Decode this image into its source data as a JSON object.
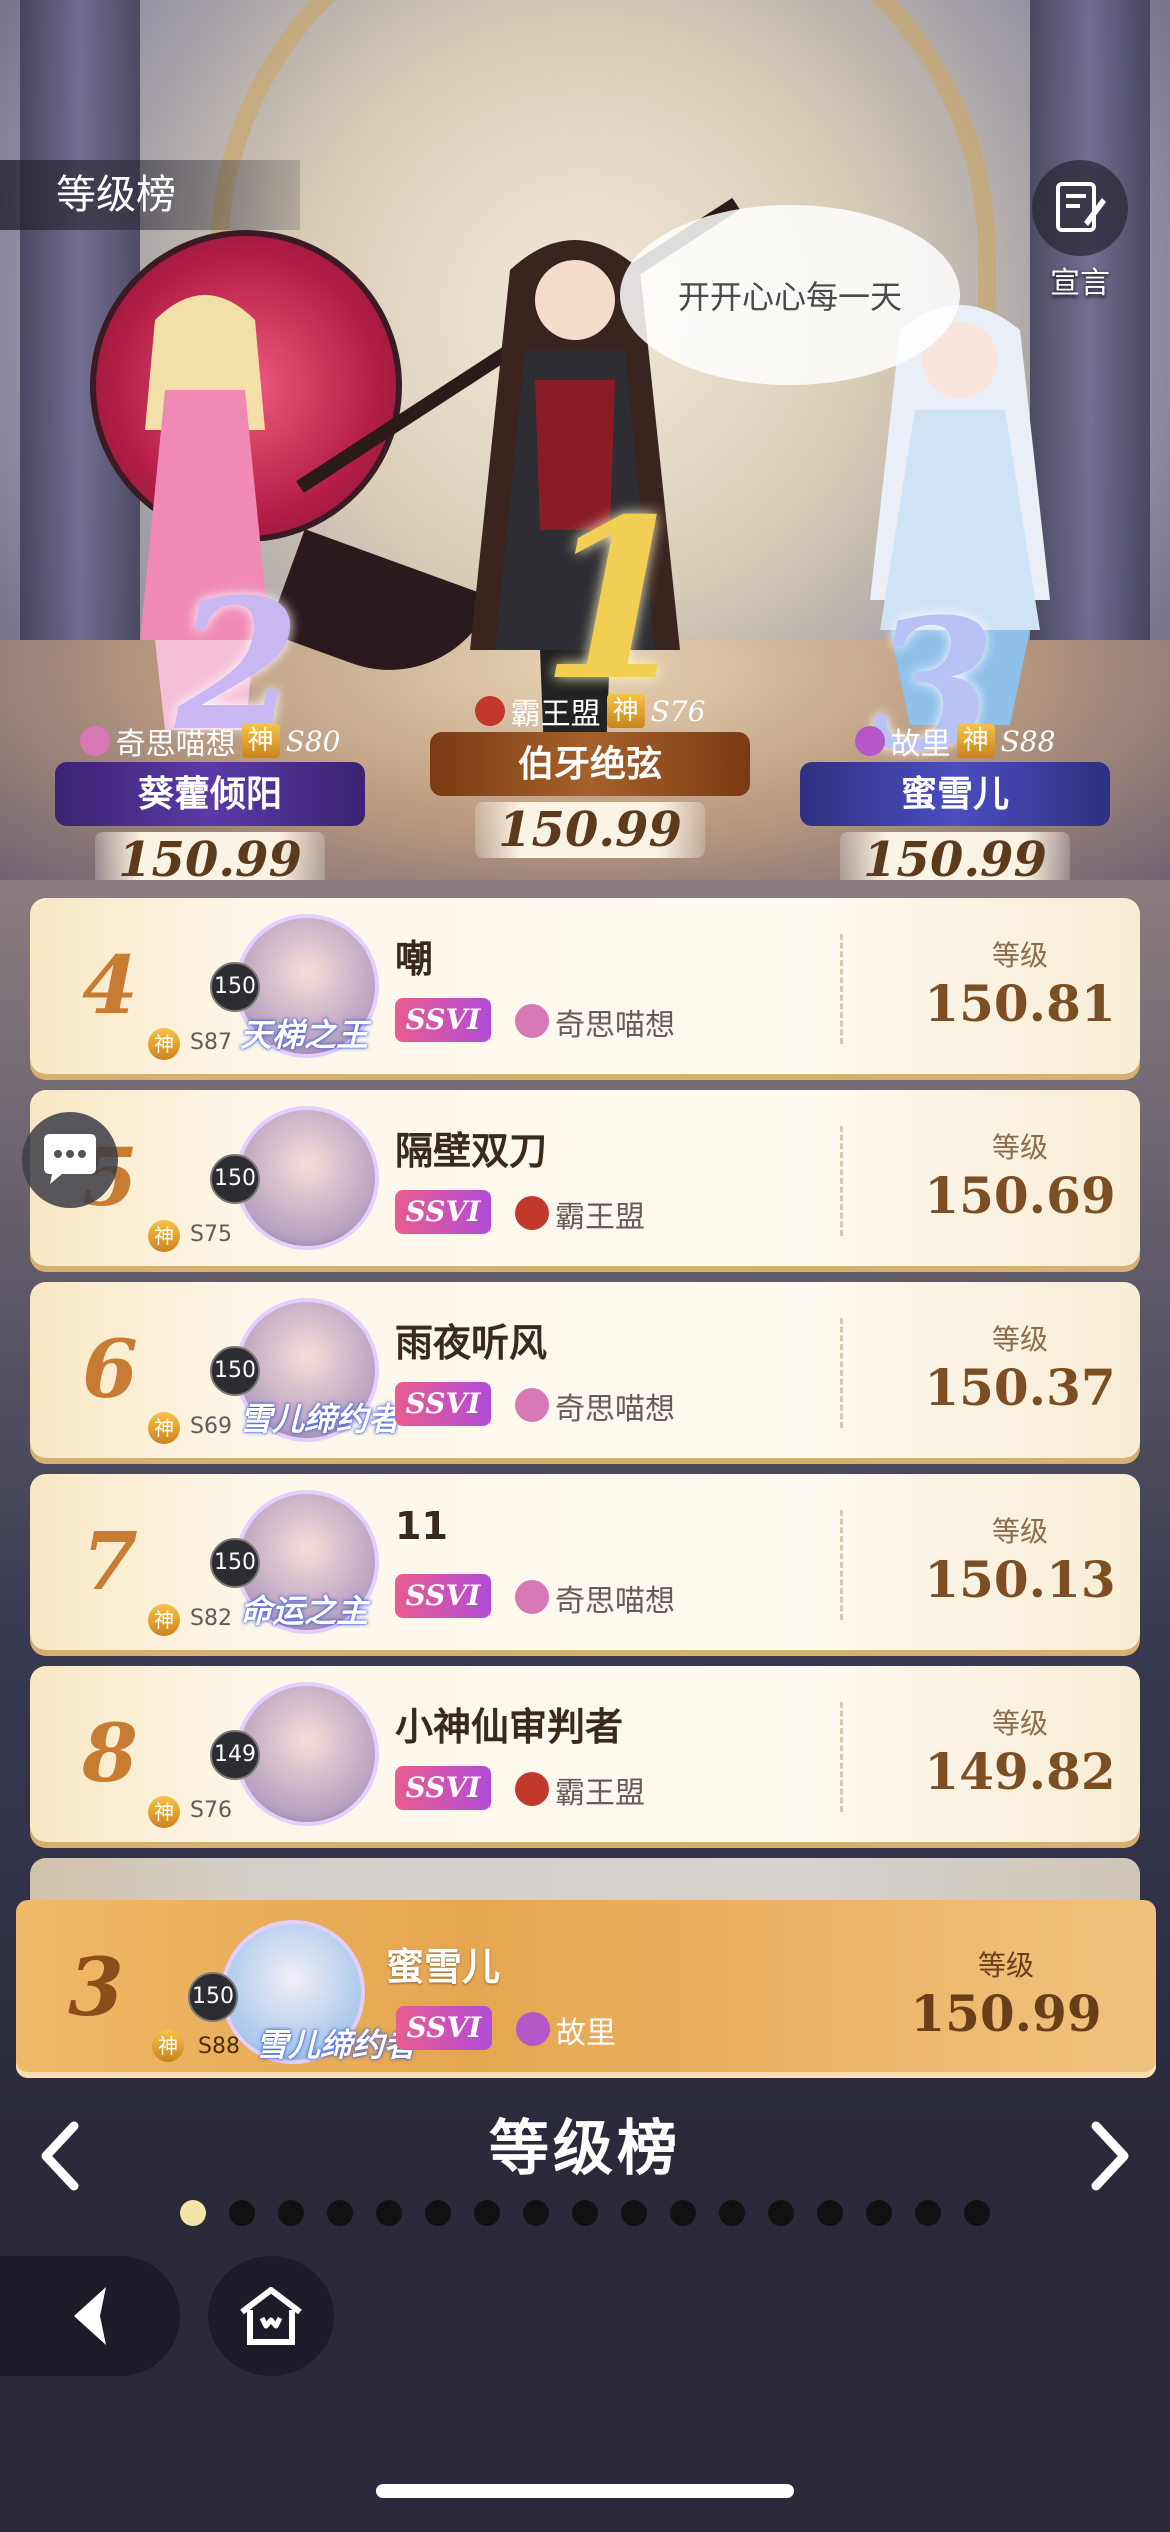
{
  "header": {
    "title": "等级榜",
    "declare_label": "宣言"
  },
  "speech_bubble": "开开心心每一天",
  "podium": [
    {
      "rank": "2",
      "guild": "奇思喵想",
      "tier": "神",
      "season": "S80",
      "name": "葵藿倾阳",
      "score": "150.99",
      "plate_color": "#4c2f8f",
      "guild_color": "#d777b6"
    },
    {
      "rank": "1",
      "guild": "霸王盟",
      "tier": "神",
      "season": "S76",
      "name": "伯牙绝弦",
      "score": "150.99",
      "plate_color": "#8a4b1e",
      "guild_color": "#c0392b"
    },
    {
      "rank": "3",
      "guild": "故里",
      "tier": "神",
      "season": "S88",
      "name": "蜜雪儿",
      "score": "150.99",
      "plate_color": "#3b3d8f",
      "guild_color": "#b557c8"
    }
  ],
  "list": {
    "level_label": "等级",
    "rows": [
      {
        "rank": "4",
        "name": "嘲",
        "avatar_level": "150",
        "tier": "神",
        "season": "S87",
        "frame_title": "天梯之王",
        "ssvi": "SSVI",
        "guild": "奇思喵想",
        "guild_color": "#d777b6",
        "level": "150.81"
      },
      {
        "rank": "5",
        "name": "隔壁双刀",
        "avatar_level": "150",
        "tier": "神",
        "season": "S75",
        "frame_title": "",
        "ssvi": "SSVI",
        "guild": "霸王盟",
        "guild_color": "#c0392b",
        "level": "150.69"
      },
      {
        "rank": "6",
        "name": "雨夜听风",
        "avatar_level": "150",
        "tier": "神",
        "season": "S69",
        "frame_title": "雪儿缔约者",
        "ssvi": "SSVI",
        "guild": "奇思喵想",
        "guild_color": "#d777b6",
        "level": "150.37"
      },
      {
        "rank": "7",
        "name": "11",
        "avatar_level": "150",
        "tier": "神",
        "season": "S82",
        "frame_title": "命运之主",
        "ssvi": "SSVI",
        "guild": "奇思喵想",
        "guild_color": "#d777b6",
        "level": "150.13"
      },
      {
        "rank": "8",
        "name": "小神仙审判者",
        "avatar_level": "149",
        "tier": "神",
        "season": "S76",
        "frame_title": "",
        "ssvi": "SSVI",
        "guild": "霸王盟",
        "guild_color": "#c0392b",
        "level": "149.82"
      }
    ]
  },
  "self": {
    "rank": "3",
    "name": "蜜雪儿",
    "avatar_level": "150",
    "tier": "神",
    "season": "S88",
    "frame_title": "雪儿缔约者",
    "ssvi": "SSVI",
    "guild": "故里",
    "guild_color": "#b557c8",
    "level_label": "等级",
    "level": "150.99"
  },
  "pager": {
    "title": "等级榜",
    "total_pages": 17,
    "current_page": 1
  },
  "icons": {
    "declare": "edit-note-icon",
    "chat": "chat-bubble-icon",
    "prev": "chevron-left-icon",
    "next": "chevron-right-icon",
    "back": "back-arrow-icon",
    "home": "home-icon"
  }
}
